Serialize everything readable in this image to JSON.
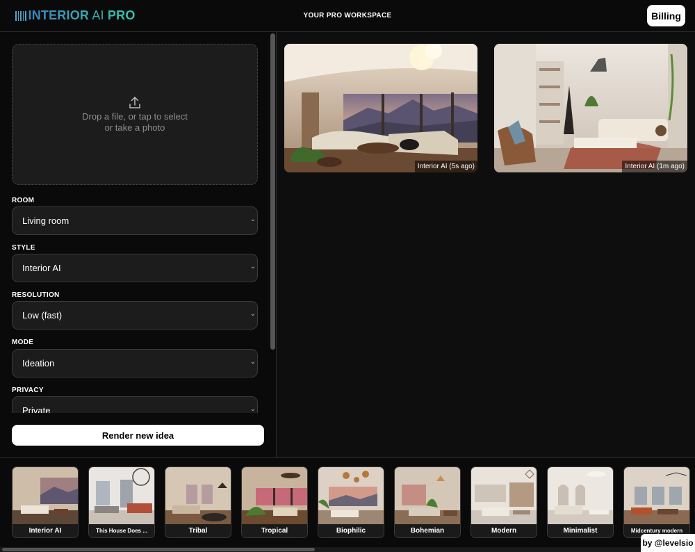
{
  "header": {
    "logo_main": "INTERIOR",
    "logo_ai": " AI",
    "logo_pro": " PRO",
    "workspace_title": "YOUR PRO WORKSPACE",
    "billing_label": "Billing"
  },
  "sidebar": {
    "dropzone_text": "Drop a file, or tap to select or take a photo",
    "fields": [
      {
        "label": "ROOM",
        "value": "Living room"
      },
      {
        "label": "STYLE",
        "value": "Interior AI"
      },
      {
        "label": "RESOLUTION",
        "value": "Low (fast)"
      },
      {
        "label": "MODE",
        "value": "Ideation"
      },
      {
        "label": "PRIVACY",
        "value": "Private"
      }
    ],
    "render_button": "Render new idea"
  },
  "results": [
    {
      "caption": "Interior AI (5s ago)"
    },
    {
      "caption": "Interior AI (1m ago)"
    }
  ],
  "styles": [
    "Interior AI",
    "This House Does ...",
    "Tribal",
    "Tropical",
    "Biophilic",
    "Bohemian",
    "Modern",
    "Minimalist",
    "Midcentury modern"
  ],
  "credit": "by @levelsio",
  "icons": {
    "upload": "upload-icon",
    "chevron": "chevron-down-icon"
  }
}
